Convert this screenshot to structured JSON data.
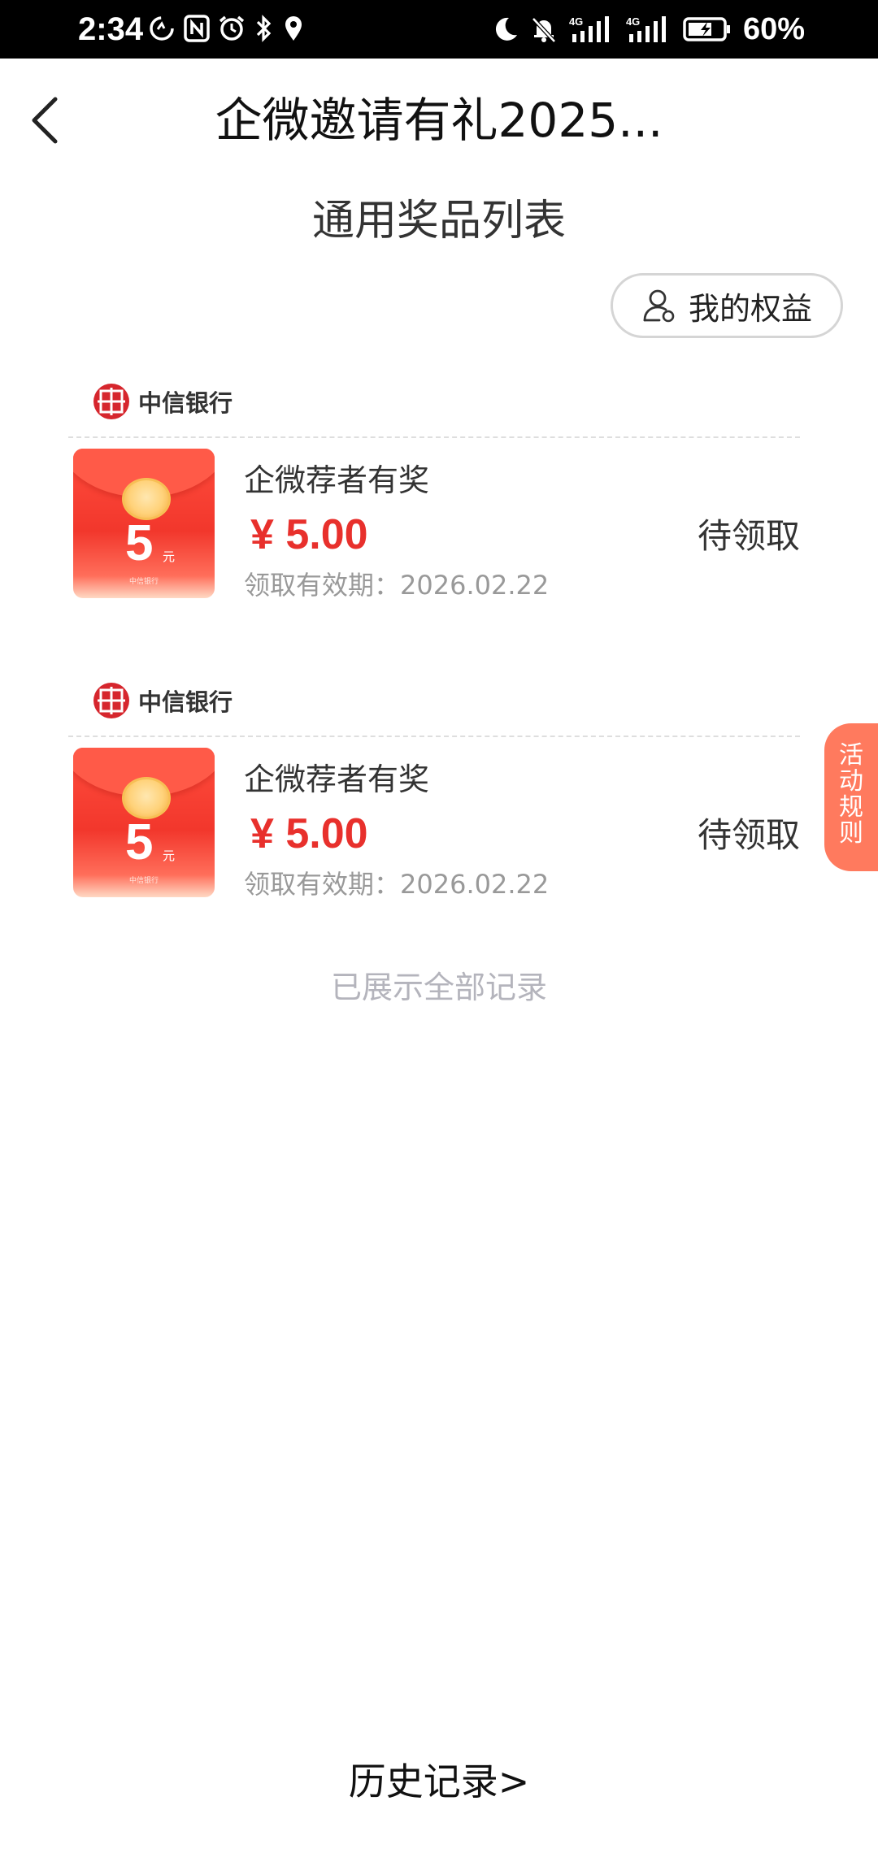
{
  "status_bar": {
    "time": "2:34",
    "battery": "60%",
    "signal_labels": [
      "4G",
      "4G"
    ],
    "icons": [
      "data-saver-icon",
      "nfc-icon",
      "alarm-icon",
      "bluetooth-icon",
      "location-icon",
      "moon-icon",
      "mute-icon",
      "signal-icon",
      "signal-icon",
      "battery-icon"
    ]
  },
  "nav": {
    "title": "企微邀请有礼2025...",
    "back_icon": "chevron-left-icon"
  },
  "section": {
    "title": "通用奖品列表"
  },
  "benefits": {
    "label": "我的权益",
    "icon": "user-icon"
  },
  "prizes": [
    {
      "bank": "中信银行",
      "name": "企微荐者有奖",
      "price": "¥ 5.00",
      "validity": "领取有效期：2026.02.22",
      "status": "待领取",
      "packet_amount": "5",
      "packet_unit": "元",
      "packet_fine": "中信银行"
    },
    {
      "bank": "中信银行",
      "name": "企微荐者有奖",
      "price": "¥ 5.00",
      "validity": "领取有效期：2026.02.22",
      "status": "待领取",
      "packet_amount": "5",
      "packet_unit": "元",
      "packet_fine": "中信银行"
    }
  ],
  "all_shown": "已展示全部记录",
  "rules_tab": [
    "活",
    "动",
    "规",
    "则"
  ],
  "history": "历史记录>",
  "colors": {
    "price": "#e8302c",
    "rules_tab": "#ff7a5e",
    "bank_logo": "#d6262d"
  }
}
